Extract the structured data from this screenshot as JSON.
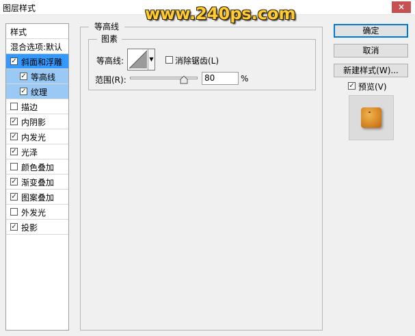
{
  "window": {
    "title": "图层样式",
    "close_glyph": "×"
  },
  "watermark": "www.240ps.com",
  "style_list": {
    "header": "样式",
    "items": [
      {
        "label": "混合选项:默认",
        "checkbox": false,
        "checked": false,
        "state": "normal"
      },
      {
        "label": "斜面和浮雕",
        "checkbox": true,
        "checked": true,
        "state": "selected"
      },
      {
        "label": "等高线",
        "checkbox": true,
        "checked": true,
        "state": "sub"
      },
      {
        "label": "纹理",
        "checkbox": true,
        "checked": true,
        "state": "sub"
      },
      {
        "label": "描边",
        "checkbox": true,
        "checked": false,
        "state": "normal"
      },
      {
        "label": "内阴影",
        "checkbox": true,
        "checked": true,
        "state": "normal"
      },
      {
        "label": "内发光",
        "checkbox": true,
        "checked": true,
        "state": "normal"
      },
      {
        "label": "光泽",
        "checkbox": true,
        "checked": true,
        "state": "normal"
      },
      {
        "label": "颜色叠加",
        "checkbox": true,
        "checked": false,
        "state": "normal"
      },
      {
        "label": "渐变叠加",
        "checkbox": true,
        "checked": true,
        "state": "normal"
      },
      {
        "label": "图案叠加",
        "checkbox": true,
        "checked": true,
        "state": "normal"
      },
      {
        "label": "外发光",
        "checkbox": true,
        "checked": false,
        "state": "normal"
      },
      {
        "label": "投影",
        "checkbox": true,
        "checked": true,
        "state": "normal"
      }
    ]
  },
  "panel": {
    "group_title": "等高线",
    "subgroup_title": "图素",
    "contour_label": "等高线:",
    "antialias_label": "消除锯齿(L)",
    "antialias_checked": false,
    "range_label": "范围(R):",
    "range_value": "80",
    "range_unit": "%",
    "range_percent": 80
  },
  "buttons": {
    "ok": "确定",
    "cancel": "取消",
    "new_style": "新建样式(W)...",
    "preview_label": "预览(V)",
    "preview_checked": true
  },
  "colors": {
    "selection": "#3399ff",
    "sub_selection": "#99c9f4",
    "close_button": "#c75050",
    "watermark": "#ffcc33"
  }
}
